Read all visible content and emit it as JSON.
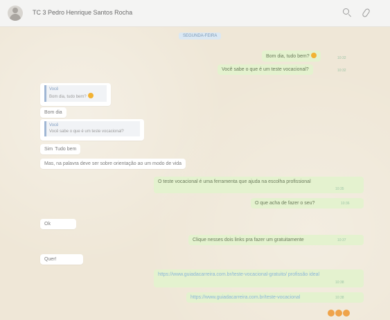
{
  "header": {
    "title": "TC 3 Pedro Henrique Santos Rocha"
  },
  "chat": {
    "date": "SEGUNDA-FEIRA",
    "messages": [
      {
        "text": "Bom dia, tudo bem?",
        "time": "10:32"
      },
      {
        "text": "Você sabe o que é um teste vocacional?",
        "time": "10:32"
      },
      {
        "quote_name": "Você",
        "quote_text": "Bom dia, tudo bem?",
        "text": "Bom dia"
      },
      {
        "quote_name": "Você",
        "quote_text": "Você sabe o que é um teste vocacional?",
        "text": "Sim"
      },
      {
        "text": "Tudo bem"
      },
      {
        "text": "Mas, na palavra deve ser sobre orientação ao um modo de vida"
      },
      {
        "text": "O teste vocacional é uma ferramenta que ajuda na escolha profissional",
        "time": "10:35"
      },
      {
        "text": "O que acha de fazer o seu?",
        "time": "10:36"
      },
      {
        "text": "Ok"
      },
      {
        "text": "Clique nesses dois links pra fazer um gratuitamente",
        "time": "10:37"
      },
      {
        "text": "Quer!"
      },
      {
        "text": "https://www.guiadacarreira.com.br/teste-vocacional-gratuito/ profissão ideal",
        "time": "10:38"
      },
      {
        "text": "https://www.guiadacarreira.com.br/teste-vocacional",
        "time": "10:38"
      }
    ]
  }
}
